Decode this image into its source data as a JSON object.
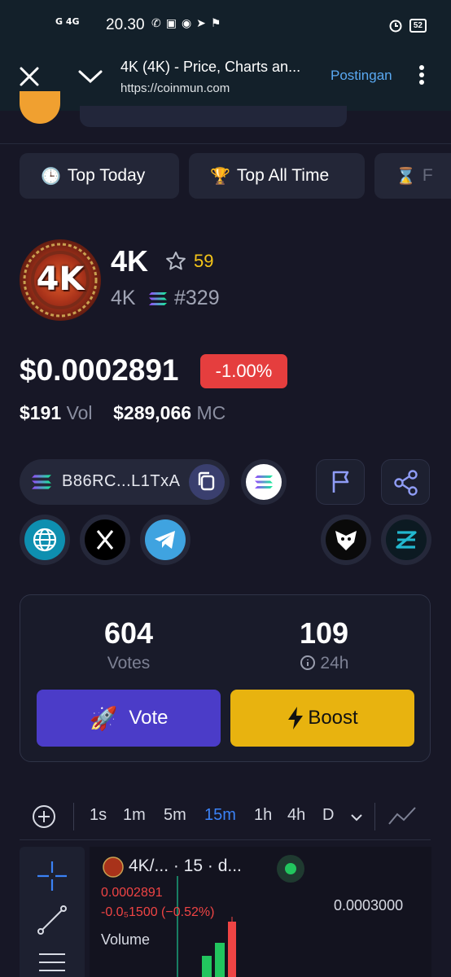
{
  "status_bar": {
    "network": "G 4G",
    "time": "20.30",
    "battery": "52"
  },
  "browser": {
    "title": "4K (4K) - Price, Charts an...",
    "url": "https://coinmun.com",
    "action": "Postingan"
  },
  "filters": [
    {
      "emoji": "🕒",
      "label": "Top Today"
    },
    {
      "emoji": "🏆",
      "label": "Top All Time"
    },
    {
      "emoji": "⌛",
      "label": "F"
    }
  ],
  "token": {
    "logo_text": "4K",
    "name": "4K",
    "star_count": "59",
    "symbol": "4K",
    "rank": "#329",
    "price": "$0.0002891",
    "change": "-1.00%",
    "volume": "$191",
    "volume_label": "Vol",
    "market_cap": "$289,066",
    "market_cap_label": "MC",
    "address": "B86RC...L1TxA"
  },
  "votes": {
    "total": "604",
    "total_label": "Votes",
    "recent": "109",
    "recent_label": "24h",
    "vote_button": "Vote",
    "boost_button": "Boost"
  },
  "chart": {
    "timeframes": [
      "1s",
      "1m",
      "5m",
      "15m",
      "1h",
      "4h",
      "D"
    ],
    "active_timeframe": "15m",
    "pair": "4K/... · 15 · d...",
    "price": "0.0002891",
    "change": "-0.0₅1500 (−0.52%)",
    "volume_label": "Volume",
    "axis_price": "0.0003000"
  },
  "colors": {
    "background": "#171726",
    "accent_blue": "#3b82f6",
    "negative": "#e53e3e",
    "vote": "#4b3cc8",
    "boost": "#e8b30f"
  }
}
